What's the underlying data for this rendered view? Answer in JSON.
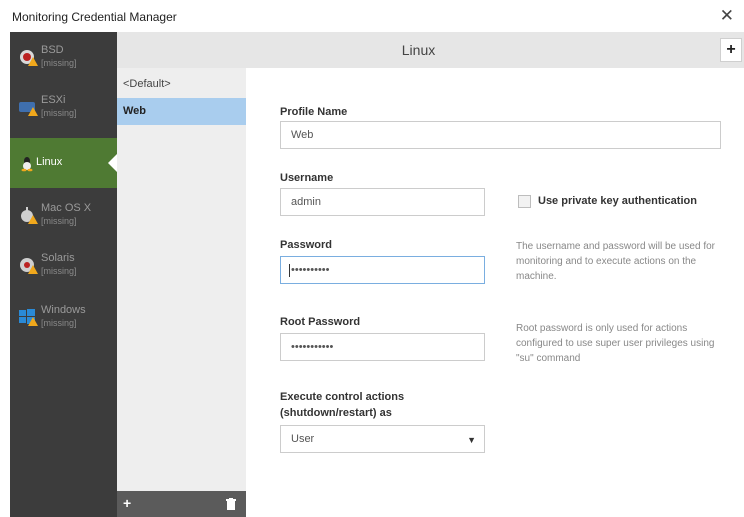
{
  "window": {
    "title": "Monitoring Credential Manager",
    "close_icon": "close-icon"
  },
  "sidebar": {
    "items": [
      {
        "name": "BSD",
        "status": "[missing]",
        "icon": "bsd-icon",
        "warning": true,
        "active": false
      },
      {
        "name": "ESXi",
        "status": "[missing]",
        "icon": "esxi-icon",
        "warning": true,
        "active": false
      },
      {
        "name": "Linux",
        "status": "",
        "icon": "linux-icon",
        "warning": false,
        "active": true
      },
      {
        "name": "Mac OS X",
        "status": "[missing]",
        "icon": "apple-icon",
        "warning": true,
        "active": false
      },
      {
        "name": "Solaris",
        "status": "[missing]",
        "icon": "solaris-icon",
        "warning": true,
        "active": false
      },
      {
        "name": "Windows",
        "status": "[missing]",
        "icon": "windows-icon",
        "warning": true,
        "active": false
      }
    ]
  },
  "header": {
    "title": "Linux",
    "add_label": "+"
  },
  "profiles": {
    "items": [
      {
        "label": "<Default>",
        "selected": false
      },
      {
        "label": "Web",
        "selected": true
      }
    ],
    "add_label": "+",
    "delete_icon": "trash-icon"
  },
  "form": {
    "profile_name_label": "Profile Name",
    "profile_name_value": "Web",
    "username_label": "Username",
    "username_value": "admin",
    "private_key_label": "Use private key authentication",
    "password_label": "Password",
    "password_value": "••••••••••",
    "password_hint": "The username and password will be used for monitoring and to execute actions on the machine.",
    "root_password_label": "Root Password",
    "root_password_value": "•••••••••••",
    "root_password_hint": "Root password is only used for actions configured to use super user privileges using \"su\" command",
    "execute_label_1": "Execute control actions",
    "execute_label_2": "(shutdown/restart) as",
    "execute_value": "User"
  },
  "colors": {
    "active_os": "#4f7a33",
    "selected_profile": "#a9cdee",
    "warning": "#f0a81c",
    "sidebar_bg": "#3c3c3c"
  }
}
